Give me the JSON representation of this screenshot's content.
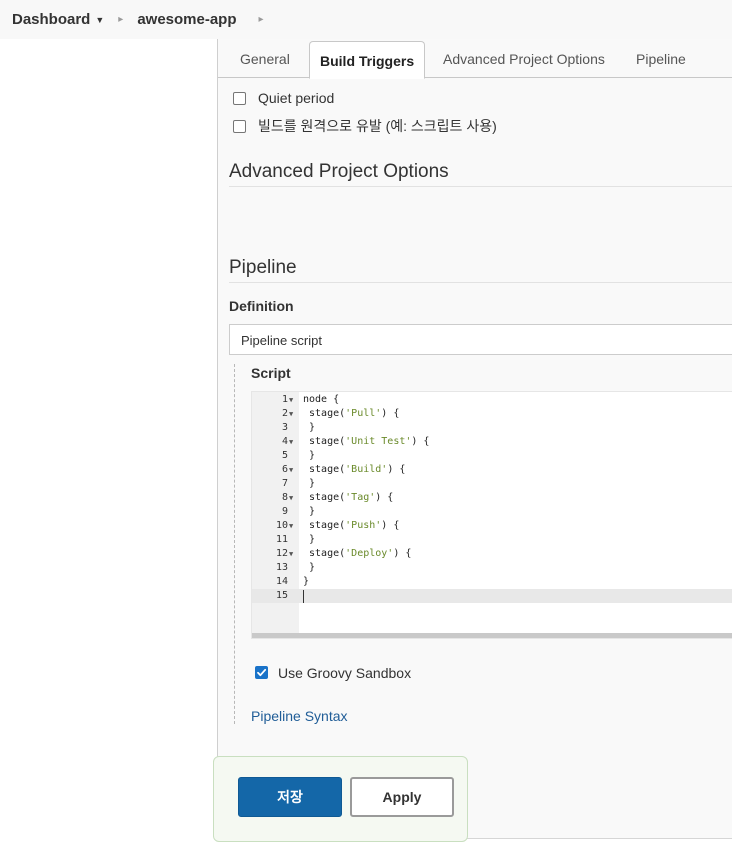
{
  "breadcrumb": {
    "items": [
      {
        "label": "Dashboard",
        "has_dropdown": true
      },
      {
        "label": "awesome-app"
      }
    ]
  },
  "tabs": [
    {
      "label": "General",
      "active": false
    },
    {
      "label": "Build Triggers",
      "active": true
    },
    {
      "label": "Advanced Project Options",
      "active": false
    },
    {
      "label": "Pipeline",
      "active": false
    }
  ],
  "build_triggers": {
    "options": [
      {
        "label": "Quiet period",
        "checked": false
      },
      {
        "label": "빌드를 원격으로 유발 (예: 스크립트 사용)",
        "checked": false
      }
    ]
  },
  "advanced_project_options": {
    "title": "Advanced Project Options"
  },
  "pipeline": {
    "title": "Pipeline",
    "definition_label": "Definition",
    "definition_value": "Pipeline script",
    "script_label": "Script",
    "script_lines": [
      {
        "n": "1",
        "fold": true,
        "code": "node {"
      },
      {
        "n": "2",
        "fold": true,
        "pre": " stage(",
        "str": "'Pull'",
        "post": ") {"
      },
      {
        "n": "3",
        "fold": false,
        "code": " }"
      },
      {
        "n": "4",
        "fold": true,
        "pre": " stage(",
        "str": "'Unit Test'",
        "post": ") {"
      },
      {
        "n": "5",
        "fold": false,
        "code": " }"
      },
      {
        "n": "6",
        "fold": true,
        "pre": " stage(",
        "str": "'Build'",
        "post": ") {"
      },
      {
        "n": "7",
        "fold": false,
        "code": " }"
      },
      {
        "n": "8",
        "fold": true,
        "pre": " stage(",
        "str": "'Tag'",
        "post": ") {"
      },
      {
        "n": "9",
        "fold": false,
        "code": " }"
      },
      {
        "n": "10",
        "fold": true,
        "pre": " stage(",
        "str": "'Push'",
        "post": ") {"
      },
      {
        "n": "11",
        "fold": false,
        "code": " }"
      },
      {
        "n": "12",
        "fold": true,
        "pre": " stage(",
        "str": "'Deploy'",
        "post": ") {"
      },
      {
        "n": "13",
        "fold": false,
        "code": " }"
      },
      {
        "n": "14",
        "fold": false,
        "code": "}"
      },
      {
        "n": "15",
        "fold": false,
        "code": "",
        "current": true
      }
    ],
    "groovy_sandbox": {
      "label": "Use Groovy Sandbox",
      "checked": true
    },
    "syntax_link": "Pipeline Syntax"
  },
  "actions": {
    "save_label": "저장",
    "apply_label": "Apply"
  },
  "colors": {
    "primary_button": "#1467a8",
    "link": "#205d97",
    "checkbox_checked": "#1a73c9"
  }
}
